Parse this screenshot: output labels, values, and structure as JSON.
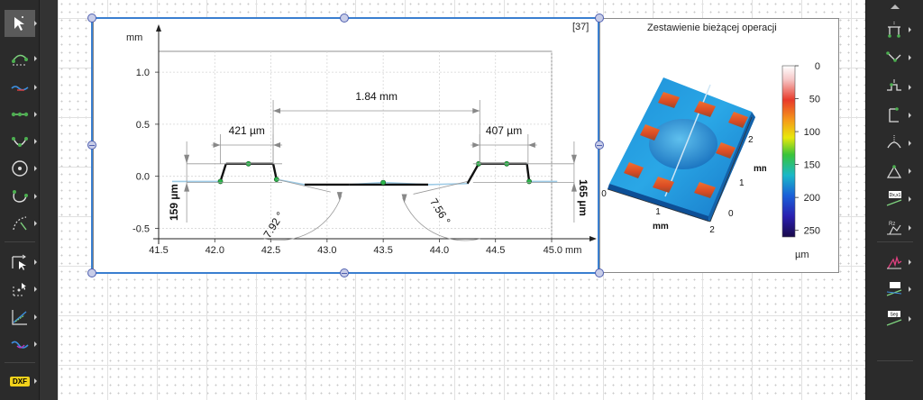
{
  "toolbar_left": [
    {
      "name": "pointer-select-tool",
      "icon": "cursor-arrow-icon"
    },
    {
      "name": "arc-fit-tool",
      "icon": "arc-icon"
    },
    {
      "name": "profile-line-tool",
      "icon": "wave-line-icon"
    },
    {
      "name": "segment-tool",
      "icon": "segment-icon"
    },
    {
      "name": "arc-three-point-tool",
      "icon": "arc-points-icon"
    },
    {
      "name": "circle-tool",
      "icon": "circle-icon"
    },
    {
      "name": "curve-tool",
      "icon": "curve-icon"
    },
    {
      "name": "fit-arc-tool",
      "icon": "dashed-arc-icon"
    },
    {
      "name": "distance-tool",
      "icon": "distance-arrows-icon"
    },
    {
      "name": "point-distance-tool",
      "icon": "point-distance-icon"
    },
    {
      "name": "graph-tool",
      "icon": "graph-icon"
    },
    {
      "name": "wave-tool",
      "icon": "wave-icon"
    }
  ],
  "toolbar_left_dxf_label": "DXF",
  "toolbar_right": [
    {
      "name": "step-height-tool",
      "icon": "step-height-icon"
    },
    {
      "name": "angle-tool",
      "icon": "angle-icon"
    },
    {
      "name": "step-tool",
      "icon": "step-icon"
    },
    {
      "name": "bracket-tool",
      "icon": "bracket-icon"
    },
    {
      "name": "peak-tool",
      "icon": "peak-icon"
    },
    {
      "name": "triangle-angle-tool",
      "icon": "triangle-angle-icon"
    },
    {
      "name": "roughness-tool",
      "icon": "roughness-icon"
    },
    {
      "name": "area-tool",
      "icon": "area-icon"
    },
    {
      "name": "parameter-chart-tool",
      "icon": "parameter-chart-icon"
    },
    {
      "name": "profile-compare-tool",
      "icon": "profile-compare-icon"
    },
    {
      "name": "segment-label-tool",
      "icon": "segment-label-icon"
    }
  ],
  "toolbar_right_labels": {
    "roughness": "Dx,x1",
    "segment": "Seg",
    "area": "Rz"
  },
  "panel": {
    "index_label": "[37]",
    "surface_title": "Zestawienie bieżącej operacji"
  },
  "chart_data": [
    {
      "type": "line",
      "title": "",
      "xlabel": "mm",
      "ylabel": "mm",
      "xlim": [
        41.5,
        45.0
      ],
      "ylim": [
        -0.6,
        1.2
      ],
      "x_ticks": [
        "41.5",
        "42.0",
        "42.5",
        "43.0",
        "43.5",
        "44.0",
        "44.5",
        "45.0 mm"
      ],
      "y_ticks": [
        "1.0",
        "0.5",
        "0.0",
        "-0.5"
      ],
      "y_unit_label": "mm",
      "grid": true,
      "series": [
        {
          "x": [
            41.62,
            42.05,
            42.1,
            42.3,
            42.52,
            42.55,
            42.8,
            43.2,
            43.5,
            43.9,
            44.25,
            44.35,
            44.6,
            44.78,
            44.8,
            45.05
          ],
          "y": [
            -0.05,
            -0.05,
            0.12,
            0.12,
            0.12,
            -0.03,
            -0.08,
            -0.08,
            -0.06,
            -0.08,
            -0.07,
            0.12,
            0.12,
            0.12,
            -0.05,
            -0.05
          ]
        }
      ],
      "annotations": {
        "width_total": "1.84 mm",
        "width_left": "421 µm",
        "width_right": "407 µm",
        "height_left": "159 µm",
        "height_right": "165 µm",
        "angle_left": "7.92 °",
        "angle_right": "7.56 °"
      }
    },
    {
      "type": "heatmap",
      "title": "Zestawienie bieżącej operacji",
      "colorbar_ticks": [
        "0",
        "50",
        "100",
        "150",
        "200",
        "250"
      ],
      "colorbar_unit": "µm",
      "colorbar_range": [
        0,
        260
      ],
      "x_axis_label": "mm",
      "x_axis_ticks": [
        "0",
        "1",
        "2"
      ],
      "y_axis_label": "mm",
      "y_axis_ticks": [
        "0",
        "1",
        "2"
      ]
    }
  ],
  "colors": {
    "profile_black": "#111111",
    "profile_blue": "#9ecbe6",
    "selection_blue": "#3a7fd0",
    "marker_green": "#2bb54a"
  }
}
